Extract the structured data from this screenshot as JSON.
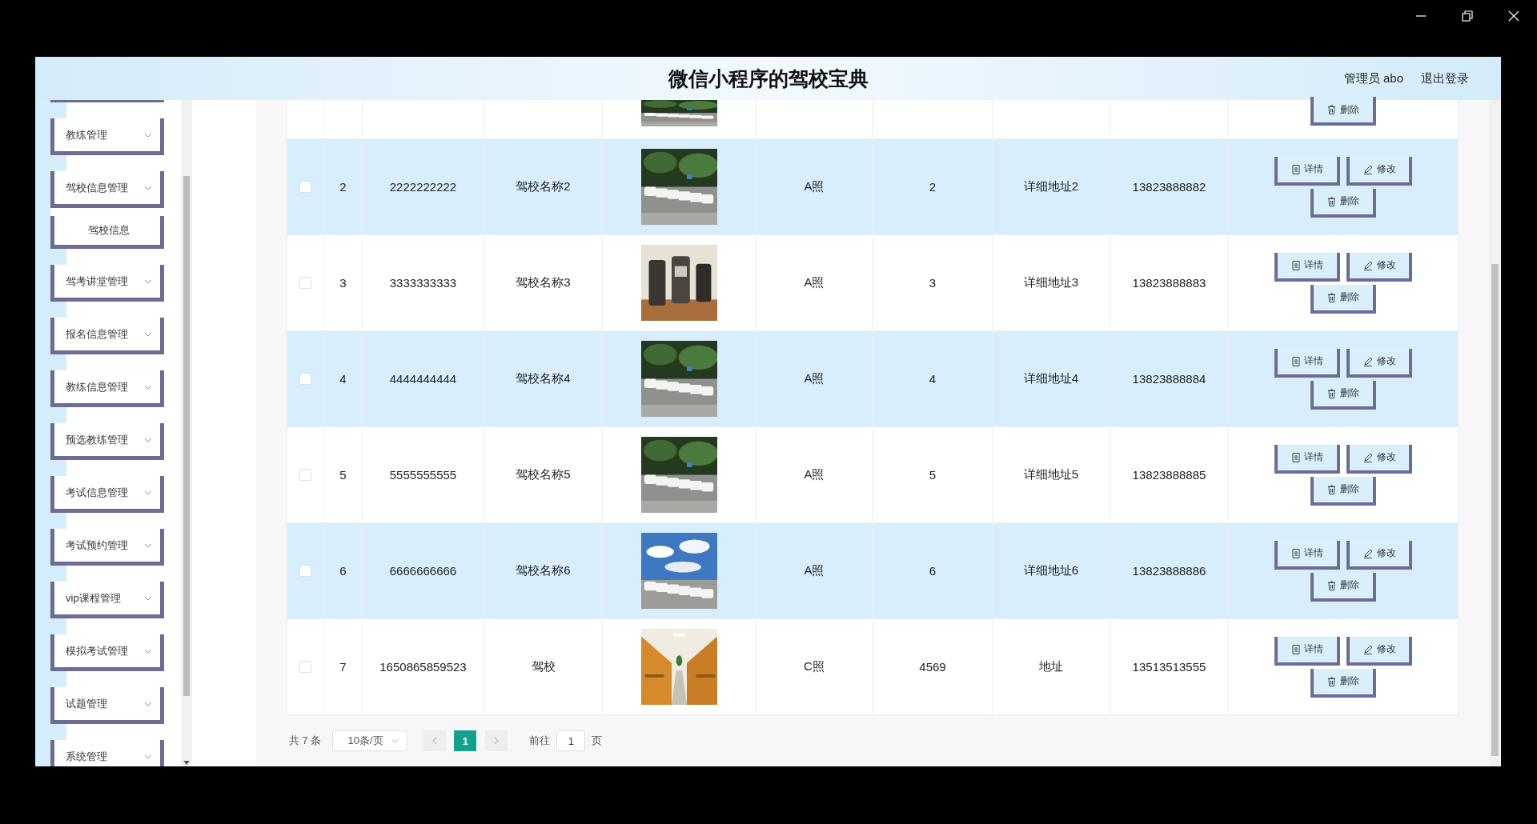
{
  "header": {
    "title": "微信小程序的驾校宝典",
    "user": "管理员 abo",
    "logout": "退出登录"
  },
  "sidebar": {
    "items": [
      {
        "label": "教练管理"
      },
      {
        "label": "驾校信息管理",
        "children": [
          {
            "label": "驾校信息"
          }
        ]
      },
      {
        "label": "驾考讲堂管理"
      },
      {
        "label": "报名信息管理"
      },
      {
        "label": "教练信息管理"
      },
      {
        "label": "预选教练管理"
      },
      {
        "label": "考试信息管理"
      },
      {
        "label": "考试预约管理"
      },
      {
        "label": "vip课程管理"
      },
      {
        "label": "模拟考试管理"
      },
      {
        "label": "试题管理"
      },
      {
        "label": "系统管理"
      }
    ]
  },
  "table": {
    "partial_row": {
      "actions": [
        {
          "kind": "delete",
          "label": "删除"
        }
      ]
    },
    "rows": [
      {
        "checked": false,
        "highlighted": true,
        "column_2": "2",
        "column_3": "2222222222",
        "column_4": "驾校名称2",
        "column_6": "A照",
        "column_7": "2",
        "column_8": "详细地址2",
        "column_9": "13823888882",
        "actions": [
          {
            "kind": "detail",
            "label": "详情"
          },
          {
            "kind": "edit",
            "label": "修改"
          },
          {
            "kind": "delete",
            "label": "删除"
          }
        ]
      },
      {
        "checked": false,
        "highlighted": false,
        "column_2": "3",
        "column_3": "3333333333",
        "column_4": "驾校名称3",
        "column_6": "A照",
        "column_7": "3",
        "column_8": "详细地址3",
        "column_9": "13823888883",
        "actions": [
          {
            "kind": "detail",
            "label": "详情"
          },
          {
            "kind": "edit",
            "label": "修改"
          },
          {
            "kind": "delete",
            "label": "删除"
          }
        ]
      },
      {
        "checked": false,
        "highlighted": true,
        "column_2": "4",
        "column_3": "4444444444",
        "column_4": "驾校名称4",
        "column_6": "A照",
        "column_7": "4",
        "column_8": "详细地址4",
        "column_9": "13823888884",
        "actions": [
          {
            "kind": "detail",
            "label": "详情"
          },
          {
            "kind": "edit",
            "label": "修改"
          },
          {
            "kind": "delete",
            "label": "删除"
          }
        ]
      },
      {
        "checked": false,
        "highlighted": false,
        "column_2": "5",
        "column_3": "5555555555",
        "column_4": "驾校名称5",
        "column_6": "A照",
        "column_7": "5",
        "column_8": "详细地址5",
        "column_9": "13823888885",
        "actions": [
          {
            "kind": "detail",
            "label": "详情"
          },
          {
            "kind": "edit",
            "label": "修改"
          },
          {
            "kind": "delete",
            "label": "删除"
          }
        ]
      },
      {
        "checked": false,
        "highlighted": true,
        "column_2": "6",
        "column_3": "6666666666",
        "column_4": "驾校名称6",
        "column_6": "A照",
        "column_7": "6",
        "column_8": "详细地址6",
        "column_9": "13823888886",
        "actions": [
          {
            "kind": "detail",
            "label": "详情"
          },
          {
            "kind": "edit",
            "label": "修改"
          },
          {
            "kind": "delete",
            "label": "删除"
          }
        ]
      },
      {
        "checked": false,
        "highlighted": false,
        "column_2": "7",
        "column_3": "1650865859523",
        "column_4": "驾校",
        "column_6": "C照",
        "column_7": "4569",
        "column_8": "地址",
        "column_9": "13513513555",
        "actions": [
          {
            "kind": "detail",
            "label": "详情"
          },
          {
            "kind": "edit",
            "label": "修改"
          },
          {
            "kind": "delete",
            "label": "删除"
          }
        ]
      }
    ]
  },
  "pagination": {
    "total": "共 7 条",
    "page_size": "10条/页",
    "pages": [
      {
        "label": "1",
        "selected": true
      }
    ],
    "goto_label": "前往",
    "goto_value": "1",
    "goto_suffix": "页"
  }
}
